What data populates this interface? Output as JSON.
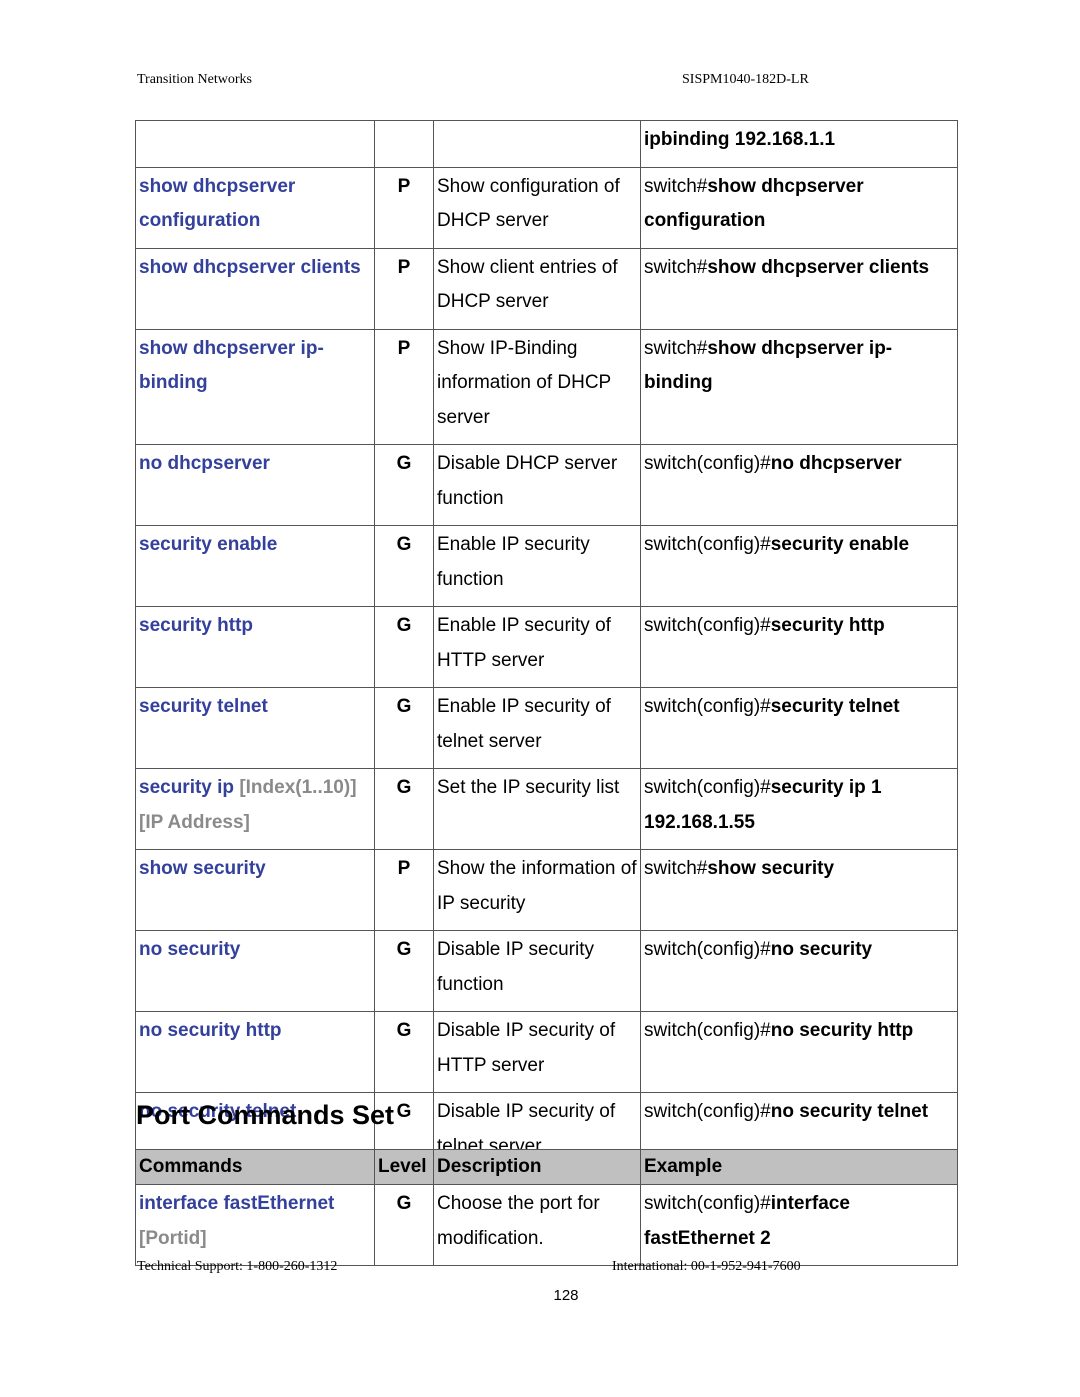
{
  "header": {
    "company": "Transition Networks",
    "model": "SISPM1040-182D-LR"
  },
  "table1": {
    "rows": [
      {
        "command": "",
        "param": "",
        "level": "",
        "description": "",
        "example_prefix": "",
        "example_bold": "ipbinding 192.168.1.1"
      },
      {
        "command": "show dhcpserver configuration",
        "param": "",
        "level": "P",
        "description": "Show configuration of DHCP server",
        "example_prefix": "switch#",
        "example_bold": "show dhcpserver configuration"
      },
      {
        "command": "show dhcpserver clients",
        "param": "",
        "level": "P",
        "description": "Show client entries of DHCP server",
        "example_prefix": "switch#",
        "example_bold": "show dhcpserver clients"
      },
      {
        "command": "show dhcpserver ip-binding",
        "param": "",
        "level": "P",
        "description": "Show IP-Binding information of DHCP server",
        "example_prefix": "switch#",
        "example_bold": "show dhcpserver ip-binding"
      },
      {
        "command": "no dhcpserver",
        "param": "",
        "level": "G",
        "description": "Disable DHCP server function",
        "example_prefix": "switch(config)#",
        "example_bold": "no dhcpserver"
      },
      {
        "command": "security enable",
        "param": "",
        "level": "G",
        "description": "Enable IP security function",
        "example_prefix": "switch(config)#",
        "example_bold": "security enable"
      },
      {
        "command": "security http",
        "param": "",
        "level": "G",
        "description": "Enable IP security of HTTP server",
        "example_prefix": "switch(config)#",
        "example_bold": "security http"
      },
      {
        "command": "security telnet",
        "param": "",
        "level": "G",
        "description": "Enable IP security of telnet server",
        "example_prefix": "switch(config)#",
        "example_bold": "security telnet"
      },
      {
        "command": "security ip",
        "param": "[Index(1..10)] [IP Address]",
        "level": "G",
        "description": "Set the IP security list",
        "example_prefix": "switch(config)#",
        "example_bold": "security ip 1 192.168.1.55"
      },
      {
        "command": "show security",
        "param": "",
        "level": "P",
        "description": "Show the information of IP security",
        "example_prefix": "switch#",
        "example_bold": "show security"
      },
      {
        "command": "no security",
        "param": "",
        "level": "G",
        "description": "Disable IP security function",
        "example_prefix": "switch(config)#",
        "example_bold": "no security"
      },
      {
        "command": "no security http",
        "param": "",
        "level": "G",
        "description": "Disable IP security of HTTP server",
        "example_prefix": "switch(config)#",
        "example_bold": "no security http"
      },
      {
        "command": "no security telnet",
        "param": "",
        "level": "G",
        "description": "Disable IP security of telnet server",
        "example_prefix": "switch(config)#",
        "example_bold": "no security telnet"
      }
    ]
  },
  "section_title": "Port Commands Set",
  "table2": {
    "headers": [
      "Commands",
      "Level",
      "Description",
      "Example"
    ],
    "rows": [
      {
        "command": "interface fastEthernet",
        "param": "[Portid]",
        "level": "G",
        "description": "Choose the port for modification.",
        "example_prefix": "switch(config)#",
        "example_bold": "interface fastEthernet 2"
      }
    ]
  },
  "footer": {
    "support": "Technical Support: 1-800-260-1312",
    "international": "International: 00-1-952-941-7600",
    "page_number": "128"
  },
  "colors": {
    "command": "#33409c",
    "param": "#8a8a8a",
    "header_bg": "#c0c0c0",
    "border": "#555555"
  }
}
